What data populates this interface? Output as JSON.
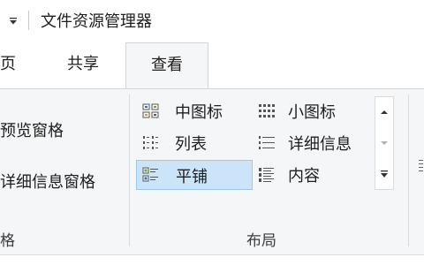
{
  "window": {
    "title": "文件资源管理器"
  },
  "tabs": {
    "home": "页",
    "share": "共享",
    "view": "查看"
  },
  "panes": {
    "preview_pane": "预览窗格",
    "details_pane": "详细信息窗格",
    "group_label": "格"
  },
  "layout": {
    "group_label": "布局",
    "items": {
      "medium_icons": "中图标",
      "small_icons": "小图标",
      "list": "列表",
      "details": "详细信息",
      "tiles": "平铺",
      "content": "内容"
    },
    "selected": "平铺"
  },
  "colors": {
    "selected_bg": "#cce4f7",
    "selected_border": "#99c9ef",
    "ribbon_bg": "#f5f6f7"
  }
}
